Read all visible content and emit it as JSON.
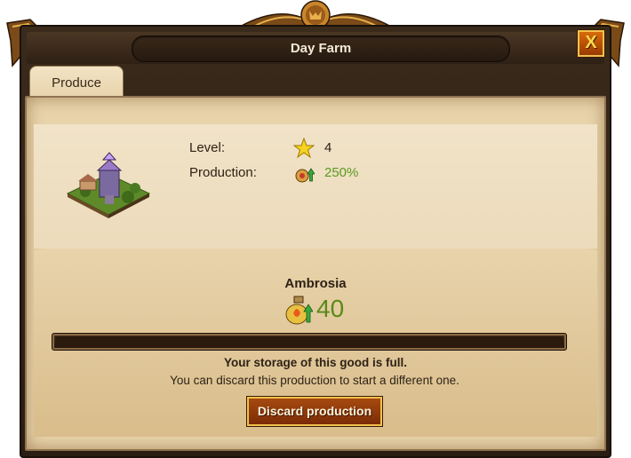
{
  "window": {
    "title": "Day Farm",
    "close_label": "X"
  },
  "tabs": [
    {
      "label": "Produce"
    }
  ],
  "building": {
    "icon": "farm-building-icon",
    "level_label": "Level:",
    "level_value": "4",
    "production_label": "Production:",
    "production_value": "250%"
  },
  "good": {
    "name": "Ambrosia",
    "icon": "ambrosia-icon",
    "amount": "40",
    "storage_fill": 1.0
  },
  "messages": {
    "storage_full": "Your storage of this good is full.",
    "discard_hint": "You can discard this production to start a different one."
  },
  "actions": {
    "discard_label": "Discard production"
  },
  "colors": {
    "frame": "#2e2015",
    "panel": "#e8d3ab",
    "accent_gold": "#f2c14c",
    "button": "#a74a10",
    "value_green": "#5a9a1e"
  }
}
